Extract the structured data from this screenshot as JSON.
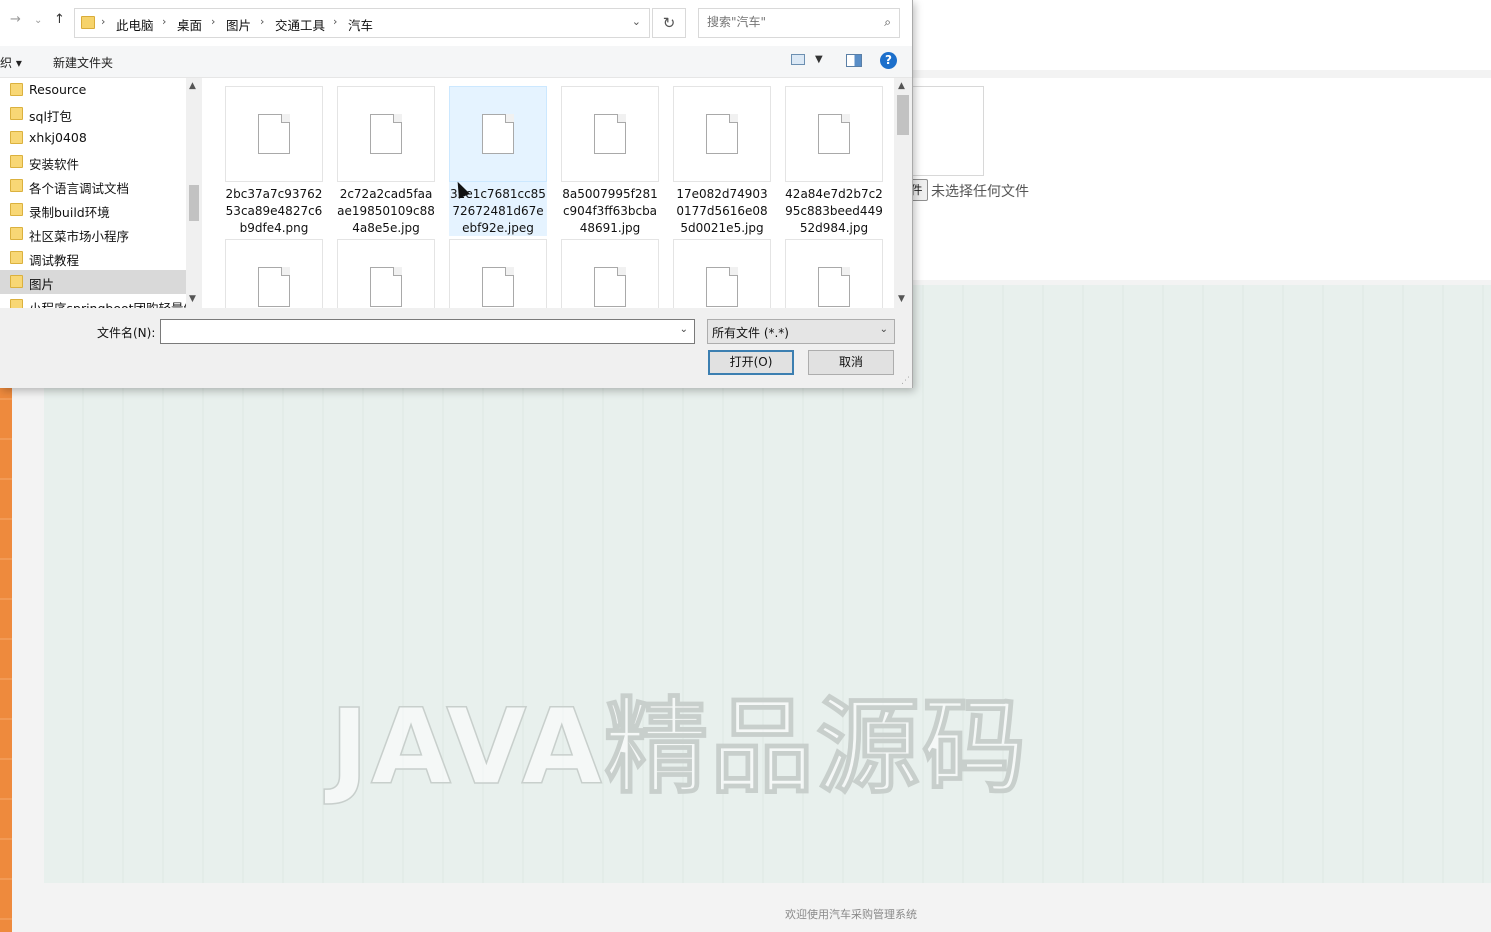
{
  "background_page": {
    "no_file_text": "未选择任何文件",
    "choose_file_label": "件",
    "watermark": "JAVA精品源码",
    "footer": "欢迎使用汽车采购管理系统"
  },
  "dialog": {
    "breadcrumbs": [
      "此电脑",
      "桌面",
      "图片",
      "交通工具",
      "汽车"
    ],
    "search": {
      "placeholder": "搜索\"汽车\""
    },
    "toolbar": {
      "organize_label": "织 ▾",
      "new_folder_label": "新建文件夹",
      "help_label": "?"
    },
    "nav_pane": {
      "items": [
        {
          "label": "Resource"
        },
        {
          "label": "sql打包"
        },
        {
          "label": "xhkj0408"
        },
        {
          "label": "安装软件"
        },
        {
          "label": "各个语言调试文档"
        },
        {
          "label": "录制build环境"
        },
        {
          "label": "社区菜市场小程序"
        },
        {
          "label": "调试教程"
        },
        {
          "label": "图片"
        },
        {
          "label": "小程序springboot团购轻量级"
        }
      ],
      "selected_index": 8
    },
    "files": [
      {
        "name": "2bc37a7c9376253ca89e4827c6b9dfe4.png"
      },
      {
        "name": "2c72a2cad5faaae19850109c884a8e5e.jpg"
      },
      {
        "name": "32e1c7681cc8572672481d67eebf92e.jpeg"
      },
      {
        "name": "8a5007995f281c904f3ff63bcba48691.jpg"
      },
      {
        "name": "17e082d749030177d5616e085d0021e5.jpg"
      },
      {
        "name": "42a84e7d2b7c295c883beed44952d984.jpg"
      }
    ],
    "selected_file_index": 2,
    "filename_label": "文件名(N):",
    "filename_value": "",
    "filetype_value": "所有文件 (*.*)",
    "open_label": "打开(O)",
    "cancel_label": "取消"
  }
}
